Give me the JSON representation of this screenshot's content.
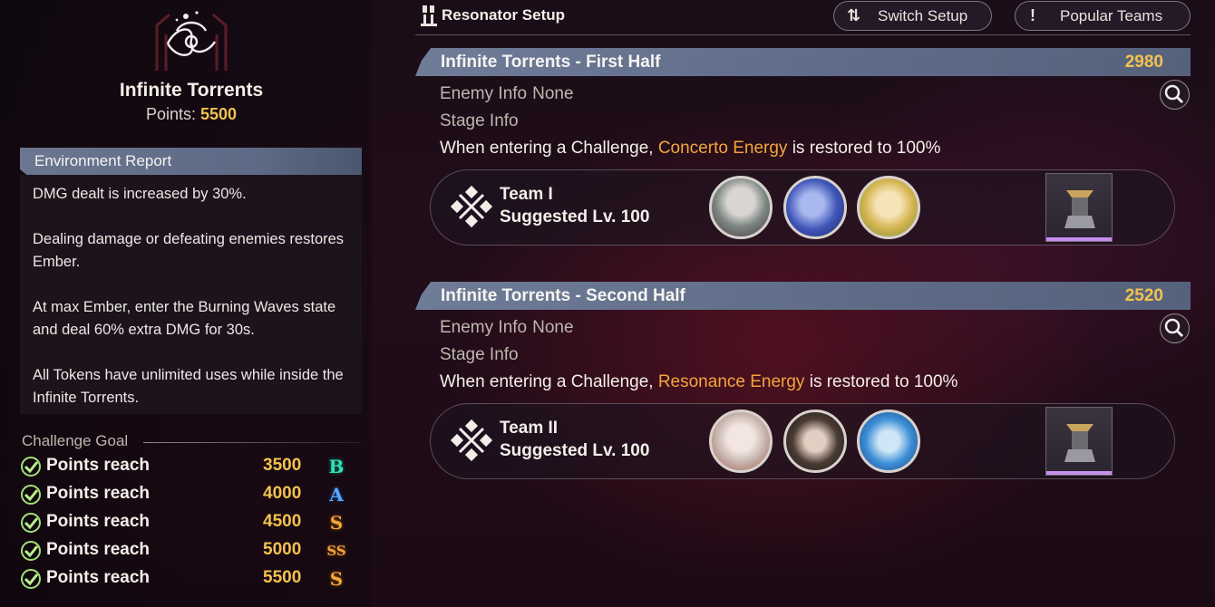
{
  "left": {
    "stage_title": "Infinite Torrents",
    "points_label": "Points:",
    "points_value": "5500",
    "environment": {
      "header": "Environment Report",
      "paragraphs": [
        "DMG dealt is increased by 30%.",
        "Dealing damage or defeating enemies restores Ember.",
        "At max Ember, enter the Burning Waves state and deal 60% extra DMG for 30s.",
        "All Tokens have unlimited uses while inside the Infinite Torrents."
      ]
    },
    "challenge_goal": {
      "title": "Challenge Goal",
      "items": [
        {
          "label": "Points reach",
          "value": "3500",
          "rank": "B"
        },
        {
          "label": "Points reach",
          "value": "4000",
          "rank": "A"
        },
        {
          "label": "Points reach",
          "value": "4500",
          "rank": "S"
        },
        {
          "label": "Points reach",
          "value": "5000",
          "rank": "SS"
        },
        {
          "label": "Points reach",
          "value": "5500",
          "rank": "S"
        }
      ]
    }
  },
  "header": {
    "title": "Resonator Setup",
    "switch_icon": "⇅",
    "switch_label": "Switch Setup",
    "popular_icon": "!",
    "popular_label": "Popular Teams"
  },
  "halves": [
    {
      "name": "Infinite Torrents - First Half",
      "score": "2980",
      "enemy_label": "Enemy Info",
      "enemy_value": "None",
      "stage_label": "Stage Info",
      "desc_pre": "When entering a Challenge,",
      "desc_hl": "Concerto Energy",
      "desc_post": "is restored to 100%",
      "team": {
        "name": "Team I",
        "level": "Suggested Lv. 100"
      }
    },
    {
      "name": "Infinite Torrents - Second Half",
      "score": "2520",
      "enemy_label": "Enemy Info",
      "enemy_value": "None",
      "stage_label": "Stage Info",
      "desc_pre": "When entering a Challenge,",
      "desc_hl": "Resonance Energy",
      "desc_post": "is restored to 100%",
      "team": {
        "name": "Team II",
        "level": "Suggested Lv. 100"
      }
    }
  ],
  "colors": {
    "accent_gold": "#f2c24f",
    "highlight_orange": "#f5a53c",
    "header_blue": "#6b7791"
  },
  "icons": [
    "tower-emblem-icon",
    "resonator-icon",
    "switch-icon",
    "exclamation-icon",
    "search-icon",
    "team-emblem-icon",
    "check-icon",
    "echo-icon"
  ]
}
